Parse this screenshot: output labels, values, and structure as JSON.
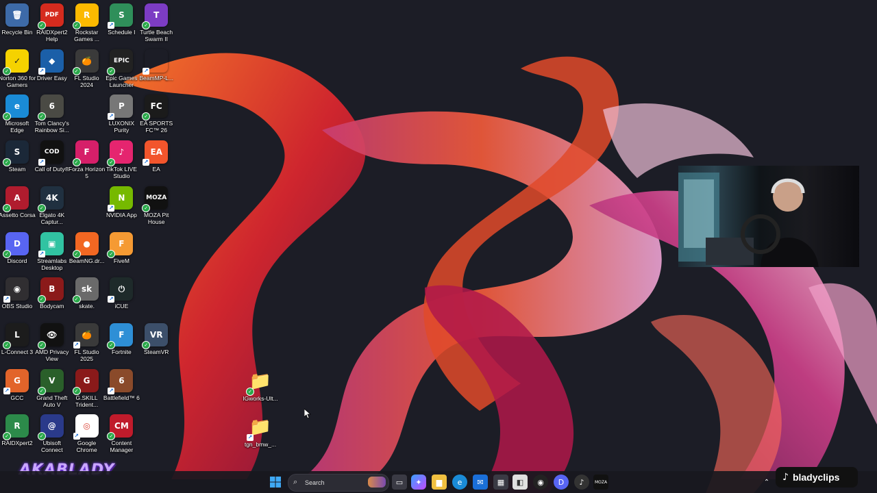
{
  "desktop": {
    "icons": [
      {
        "name": "recycle-bin",
        "label": "Recycle Bin",
        "glyph": "🗑",
        "bg": "#3d6aa8"
      },
      {
        "name": "raidxpert2-help",
        "label": "RAIDXpert2 Help",
        "glyph": "PDF",
        "bg": "#d52b1e"
      },
      {
        "name": "rockstar-games",
        "label": "Rockstar Games ...",
        "glyph": "R",
        "bg": "#fcb900"
      },
      {
        "name": "schedule-i",
        "label": "Schedule I",
        "glyph": "S",
        "bg": "#2f8f5a"
      },
      {
        "name": "turtle-beach",
        "label": "Turtle Beach Swarm II",
        "glyph": "T",
        "bg": "#7c3cc4"
      },
      {
        "name": "norton-360",
        "label": "Norton 360 for Gamers",
        "glyph": "✓",
        "bg": "#f5d200"
      },
      {
        "name": "driver-easy",
        "label": "Driver Easy",
        "glyph": "◆",
        "bg": "#1b5fa8"
      },
      {
        "name": "fl-studio-2024",
        "label": "FL Studio 2024",
        "glyph": "🍊",
        "bg": "#3a3a3a"
      },
      {
        "name": "epic-games",
        "label": "Epic Games Launcher",
        "glyph": "EPIC",
        "bg": "#222"
      },
      {
        "name": "beammp",
        "label": "BeamMP-L...",
        "glyph": "",
        "bg": "transparent"
      },
      {
        "name": "microsoft-edge",
        "label": "Microsoft Edge",
        "glyph": "e",
        "bg": "#1a8bd6"
      },
      {
        "name": "rainbow-six",
        "label": "Tom Clancy's Rainbow Si...",
        "glyph": "6",
        "bg": "#4a4a44"
      },
      {
        "name": "luxonix-purity",
        "label": "LUXONIX Purity",
        "glyph": "P",
        "bg": "#777"
      },
      {
        "name": "ea-sports-fc26",
        "label": "EA SPORTS FC™ 26",
        "glyph": "FC",
        "bg": "#1b1b1b"
      },
      {
        "name": "steam",
        "label": "Steam",
        "glyph": "S",
        "bg": "#1b2838"
      },
      {
        "name": "call-of-duty",
        "label": "Call of Duty®",
        "glyph": "COD",
        "bg": "#111"
      },
      {
        "name": "forza-horizon-5",
        "label": "Forza Horizon 5",
        "glyph": "F",
        "bg": "#d61f69"
      },
      {
        "name": "tiktok-live-studio",
        "label": "TikTok LIVE Studio",
        "glyph": "♪",
        "bg": "#e5256f"
      },
      {
        "name": "ea",
        "label": "EA",
        "glyph": "EA",
        "bg": "#f2552c"
      },
      {
        "name": "assetto-corsa",
        "label": "Assetto Corsa",
        "glyph": "A",
        "bg": "#b01c2e"
      },
      {
        "name": "elgato-4k",
        "label": "Elgato 4K Captur...",
        "glyph": "4K",
        "bg": "#203040"
      },
      {
        "name": "nvidia-app",
        "label": "NVIDIA App",
        "glyph": "N",
        "bg": "#76b900"
      },
      {
        "name": "moza-pit-house",
        "label": "MOZA Pit House",
        "glyph": "MOZA",
        "bg": "#111"
      },
      {
        "name": "discord",
        "label": "Discord",
        "glyph": "D",
        "bg": "#5865f2"
      },
      {
        "name": "streamlabs",
        "label": "Streamlabs Desktop",
        "glyph": "▣",
        "bg": "#31c3a2"
      },
      {
        "name": "beamng",
        "label": "BeamNG.dr...",
        "glyph": "●",
        "bg": "#f26722"
      },
      {
        "name": "fivem",
        "label": "FiveM",
        "glyph": "F",
        "bg": "#f59a33"
      },
      {
        "name": "obs-studio",
        "label": "OBS Studio",
        "glyph": "◉",
        "bg": "#302e31"
      },
      {
        "name": "bodycam",
        "label": "Bodycam",
        "glyph": "B",
        "bg": "#8b1a1a"
      },
      {
        "name": "skate",
        "label": "skate.",
        "glyph": "sk",
        "bg": "#6a6a6a"
      },
      {
        "name": "icue",
        "label": "iCUE",
        "glyph": "⏻",
        "bg": "#1e2a2a"
      },
      {
        "name": "l-connect-3",
        "label": "L-Connect 3",
        "glyph": "L",
        "bg": "#1c1c1c"
      },
      {
        "name": "amd-privacy-view",
        "label": "AMD Privacy View",
        "glyph": "👁",
        "bg": "#111"
      },
      {
        "name": "fl-studio-2025",
        "label": "FL Studio 2025",
        "glyph": "🍊",
        "bg": "#3a3a3a"
      },
      {
        "name": "fortnite",
        "label": "Fortnite",
        "glyph": "F",
        "bg": "#2e8fd6"
      },
      {
        "name": "steamvr",
        "label": "SteamVR",
        "glyph": "VR",
        "bg": "#3c4f6a"
      },
      {
        "name": "gcc",
        "label": "GCC",
        "glyph": "G",
        "bg": "#e2642a"
      },
      {
        "name": "gta-v",
        "label": "Grand Theft Auto V",
        "glyph": "V",
        "bg": "#2a5f2a"
      },
      {
        "name": "gskill-trident",
        "label": "G.SKILL Trident...",
        "glyph": "G",
        "bg": "#8a1a1a"
      },
      {
        "name": "battlefield-6",
        "label": "Battlefield™ 6",
        "glyph": "6",
        "bg": "#8a4a2a"
      },
      {
        "name": "raidxpert2",
        "label": "RAIDXpert2",
        "glyph": "R",
        "bg": "#2c8a4a"
      },
      {
        "name": "ubisoft-connect",
        "label": "Ubisoft Connect",
        "glyph": "@",
        "bg": "#2a3a8a"
      },
      {
        "name": "google-chrome",
        "label": "Google Chrome",
        "glyph": "◎",
        "bg": "#ffffff"
      },
      {
        "name": "content-manager",
        "label": "Content Manager",
        "glyph": "CM",
        "bg": "#c01b2b"
      },
      {
        "name": "igworks-folder",
        "label": "IGworks-Ult...",
        "glyph": "📁",
        "bg": "transparent"
      },
      {
        "name": "tgn-bmw-folder",
        "label": "tgn_bmw_...",
        "glyph": "📁",
        "bg": "transparent"
      }
    ]
  },
  "taskbar": {
    "search_placeholder": "Search",
    "search_icon": "search-icon",
    "apps": [
      "start",
      "search",
      "widgets",
      "task-view",
      "copilot",
      "file-explorer",
      "edge",
      "outlook",
      "store",
      "roblox-studio",
      "obs",
      "discord",
      "tiktok-live",
      "moza"
    ]
  },
  "overlay": {
    "streamer_logo": "AKABLADY",
    "tiktok_handle": "bladyclips"
  }
}
